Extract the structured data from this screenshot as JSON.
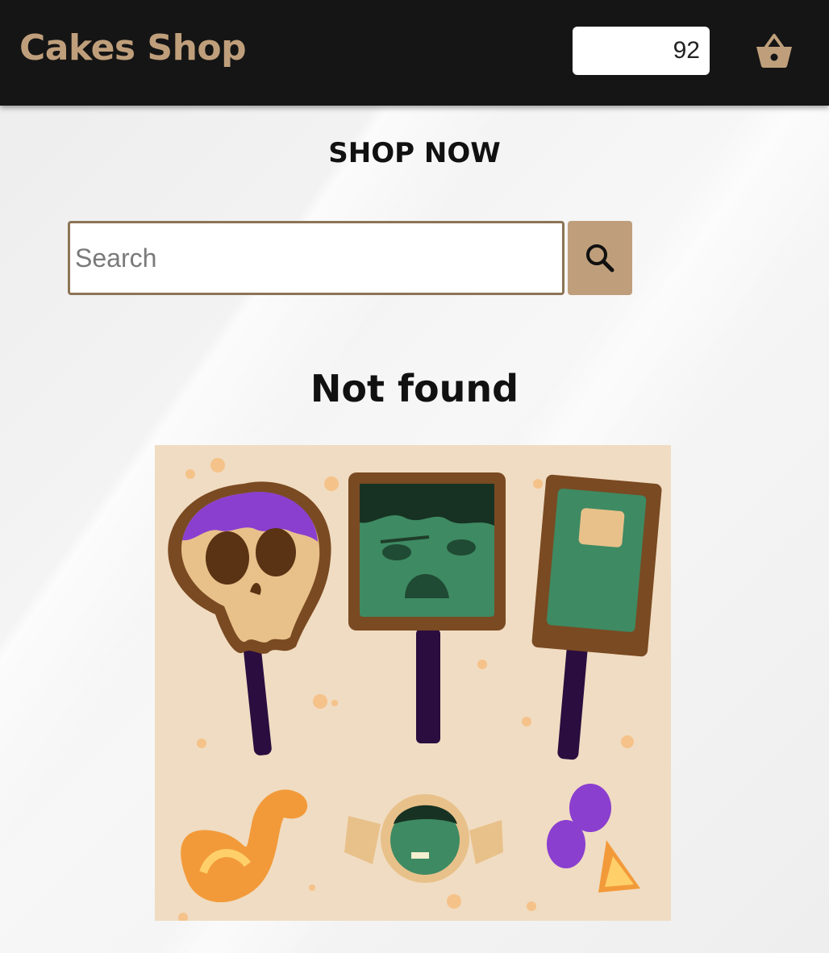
{
  "header": {
    "brand": "Cakes Shop",
    "cart_count": "92",
    "cart_icon": "basket-icon"
  },
  "main": {
    "heading": "SHOP NOW",
    "search": {
      "placeholder": "Search",
      "value": "",
      "button_icon": "search-icon"
    },
    "empty_message": "Not found"
  },
  "colors": {
    "header_bg": "#151515",
    "brand": "#bf9f7b",
    "accent": "#bf9f7b",
    "input_border": "#8c7455"
  }
}
